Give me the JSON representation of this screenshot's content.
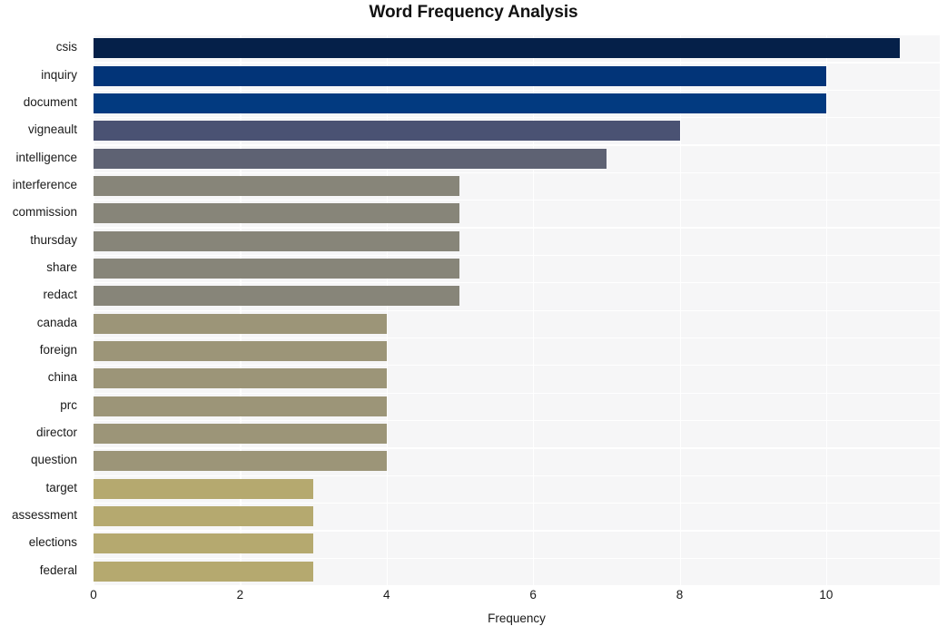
{
  "chart_data": {
    "type": "bar",
    "orientation": "horizontal",
    "title": "Word Frequency Analysis",
    "xlabel": "Frequency",
    "ylabel": "",
    "categories": [
      "csis",
      "inquiry",
      "document",
      "vigneault",
      "intelligence",
      "interference",
      "commission",
      "thursday",
      "share",
      "redact",
      "canada",
      "foreign",
      "china",
      "prc",
      "director",
      "question",
      "target",
      "assessment",
      "elections",
      "federal"
    ],
    "values": [
      11,
      10,
      10,
      8,
      7,
      5,
      5,
      5,
      5,
      5,
      4,
      4,
      4,
      4,
      4,
      4,
      3,
      3,
      3,
      3
    ],
    "bar_colors": [
      "#052049",
      "#023478",
      "#023a80",
      "#4a5273",
      "#5e6273",
      "#878579",
      "#878579",
      "#878579",
      "#878579",
      "#878579",
      "#9c9578",
      "#9c9578",
      "#9c9578",
      "#9c9578",
      "#9c9578",
      "#9c9578",
      "#b5a96f",
      "#b5a96f",
      "#b5a96f",
      "#b5a96f"
    ],
    "xticks": [
      0,
      2,
      4,
      6,
      8,
      10
    ],
    "xtick_labels": [
      "0",
      "2",
      "4",
      "6",
      "8",
      "10"
    ],
    "xlim": [
      0,
      11.55
    ],
    "grid": true,
    "grid_color": "#ffffff",
    "plot_background": "#f6f6f7",
    "figure_background": "#ffffff",
    "legend": null
  }
}
